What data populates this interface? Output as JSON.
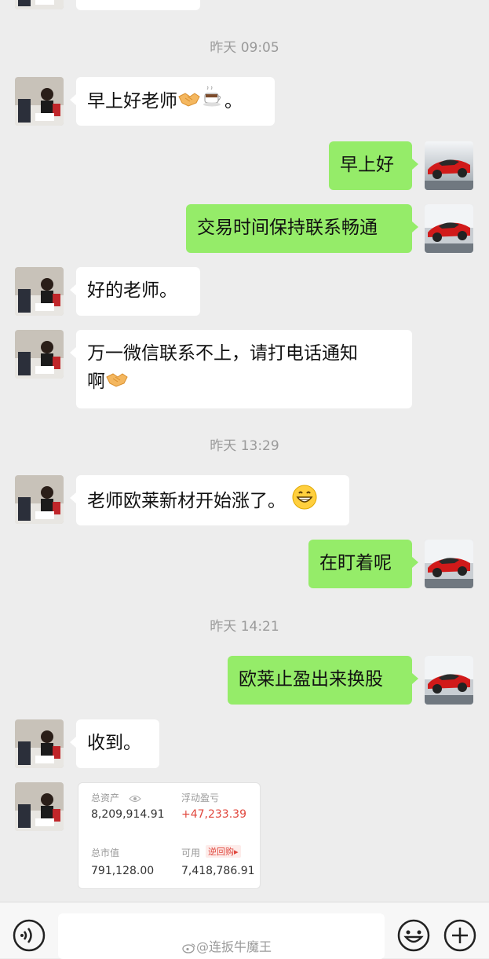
{
  "timestamps": [
    "昨天 09:05",
    "昨天 13:29",
    "昨天 14:21"
  ],
  "messages": [
    {
      "side": "left",
      "text": "早上好老师",
      "suffix": "。",
      "emoji": [
        "handshake-icon",
        "coffee-icon"
      ]
    },
    {
      "side": "right",
      "text": "早上好"
    },
    {
      "side": "right",
      "text": "交易时间保持联系畅通"
    },
    {
      "side": "left",
      "text": "好的老师。"
    },
    {
      "side": "left",
      "text": "万一微信联系不上，请打电话通知",
      "line2": "啊",
      "emoji": [
        "handshake-icon"
      ]
    },
    {
      "side": "left",
      "text": "老师欧莱新材开始涨了。",
      "emoji": [
        "grinning-face-icon"
      ]
    },
    {
      "side": "right",
      "text": "在盯着呢"
    },
    {
      "side": "right",
      "text": "欧莱止盈出来换股"
    },
    {
      "side": "left",
      "text": "收到。"
    }
  ],
  "account_card": {
    "total_assets_label": "总资产",
    "total_assets_value": "8,209,914.91",
    "floating_pl_label": "浮动盈亏",
    "floating_pl_value": "+47,233.39",
    "market_value_label": "总市值",
    "market_value_value": "791,128.00",
    "available_label": "可用",
    "reverse_repo_label": "逆回购▸",
    "available_value": "7,418,786.91"
  },
  "watermark": "@连扳牛魔王",
  "colors": {
    "background": "#ededed",
    "bubble_left": "#ffffff",
    "bubble_right": "#95ec69",
    "profit_red": "#e0463c"
  }
}
